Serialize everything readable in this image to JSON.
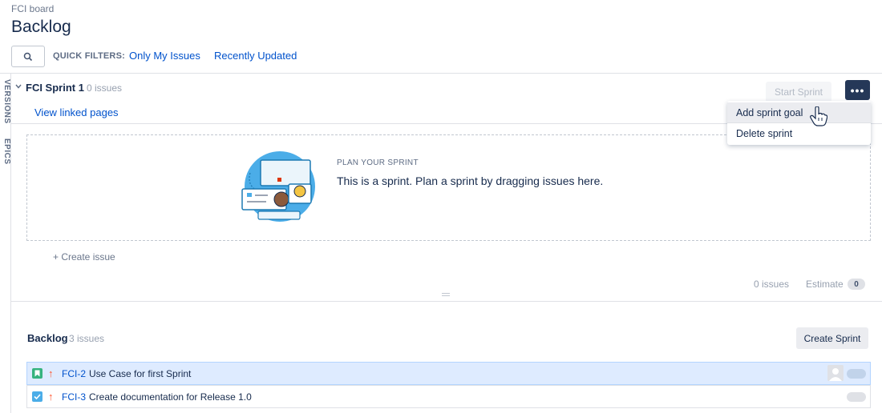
{
  "breadcrumb": "FCI board",
  "page_title": "Backlog",
  "quick_filters": {
    "label": "QUICK FILTERS:",
    "items": [
      "Only My Issues",
      "Recently Updated"
    ]
  },
  "side_tabs": [
    "VERSIONS",
    "EPICS"
  ],
  "sprint": {
    "name": "FCI Sprint 1",
    "count": "0 issues",
    "start_label": "Start Sprint",
    "more_label": "•••",
    "view_linked": "View linked pages",
    "plan_title": "PLAN YOUR SPRINT",
    "plan_text": "This is a sprint. Plan a sprint by dragging issues here.",
    "create_issue": "+   Create issue",
    "footer_issues": "0 issues",
    "footer_estimate_label": "Estimate",
    "footer_estimate_value": "0"
  },
  "dropdown": {
    "items": [
      "Add sprint goal",
      "Delete sprint"
    ]
  },
  "backlog": {
    "name": "Backlog",
    "count": "3 issues",
    "create_sprint_label": "Create Sprint",
    "issues": [
      {
        "key": "FCI-2",
        "summary": "Use Case for first Sprint",
        "type": "story",
        "selected": true
      },
      {
        "key": "FCI-3",
        "summary": "Create documentation for Release 1.0",
        "type": "task",
        "selected": false
      }
    ]
  },
  "colors": {
    "link": "#0052cc",
    "story": "#36b37e",
    "task": "#4bade8",
    "priority_high": "#ff5630",
    "more_button": "#253858"
  }
}
